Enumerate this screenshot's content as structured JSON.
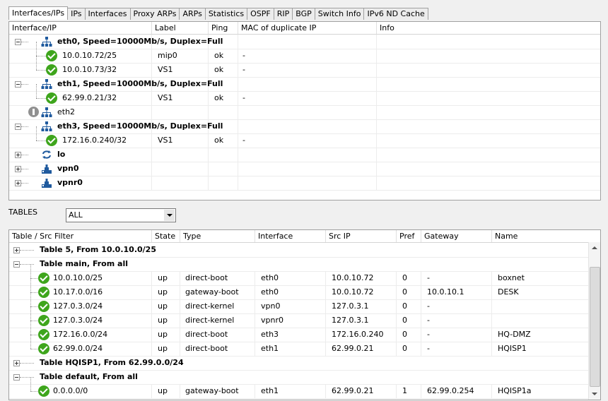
{
  "tabs": [
    "Interfaces/IPs",
    "IPs",
    "Interfaces",
    "Proxy ARPs",
    "ARPs",
    "Statistics",
    "OSPF",
    "RIP",
    "BGP",
    "Switch Info",
    "IPv6 ND Cache"
  ],
  "iface_headers": [
    "Interface/IP",
    "Label",
    "Ping",
    "MAC of duplicate IP",
    "Info"
  ],
  "iface_rows": [
    {
      "type": "iface",
      "icon": "network-icon",
      "name": "eth0, Speed=10000Mb/s, Duplex=Full",
      "bold": true,
      "expander": "minus"
    },
    {
      "type": "ip",
      "ip": "10.0.10.72/25",
      "label": "mip0",
      "ping": "ok",
      "mac": "-"
    },
    {
      "type": "ip",
      "ip": "10.0.10.73/32",
      "label": "VS1",
      "ping": "ok",
      "mac": "-"
    },
    {
      "type": "iface",
      "icon": "network-icon",
      "name": "eth1, Speed=10000Mb/s, Duplex=Full",
      "bold": true,
      "expander": "minus"
    },
    {
      "type": "ip",
      "ip": "62.99.0.21/32",
      "label": "VS1",
      "ping": "ok",
      "mac": "-"
    },
    {
      "type": "iface",
      "icon": "network-icon",
      "warn": true,
      "name": "eth2",
      "bold": false,
      "expander": "none"
    },
    {
      "type": "iface",
      "icon": "network-icon",
      "name": "eth3, Speed=10000Mb/s, Duplex=Full",
      "bold": true,
      "expander": "minus"
    },
    {
      "type": "ip",
      "ip": "172.16.0.240/32",
      "label": "VS1",
      "ping": "ok",
      "mac": "-"
    },
    {
      "type": "iface",
      "icon": "loopback-icon",
      "name": "lo",
      "bold": true,
      "expander": "plus"
    },
    {
      "type": "iface",
      "icon": "vpn-icon",
      "name": "vpn0",
      "bold": true,
      "expander": "plus"
    },
    {
      "type": "iface",
      "icon": "vpn-icon",
      "name": "vpnr0",
      "bold": true,
      "expander": "plus"
    }
  ],
  "tables_label": "TABLES",
  "tables_select": "ALL",
  "route_headers": [
    "Table / Src Filter",
    "State",
    "Type",
    "Interface",
    "Src IP",
    "Pref",
    "Gateway",
    "Name"
  ],
  "route_rows": [
    {
      "type": "table",
      "name": "Table 5, From 10.0.10.0/25",
      "expander": "plus"
    },
    {
      "type": "table",
      "name": "Table main, From all",
      "expander": "minus"
    },
    {
      "type": "route",
      "dest": "10.0.10.0/25",
      "state": "up",
      "rtype": "direct-boot",
      "iface": "eth0",
      "src": "10.0.10.72",
      "pref": "0",
      "gw": "-",
      "name": "boxnet"
    },
    {
      "type": "route",
      "dest": "10.17.0.0/16",
      "state": "up",
      "rtype": "gateway-boot",
      "iface": "eth0",
      "src": "10.0.10.72",
      "pref": "0",
      "gw": "10.0.10.1",
      "name": "DESK"
    },
    {
      "type": "route",
      "dest": "127.0.3.0/24",
      "state": "up",
      "rtype": "direct-kernel",
      "iface": "vpn0",
      "src": "127.0.3.1",
      "pref": "0",
      "gw": "-",
      "name": ""
    },
    {
      "type": "route",
      "dest": "127.0.3.0/24",
      "state": "up",
      "rtype": "direct-kernel",
      "iface": "vpnr0",
      "src": "127.0.3.1",
      "pref": "0",
      "gw": "-",
      "name": ""
    },
    {
      "type": "route",
      "dest": "172.16.0.0/24",
      "state": "up",
      "rtype": "direct-boot",
      "iface": "eth3",
      "src": "172.16.0.240",
      "pref": "0",
      "gw": "-",
      "name": "HQ-DMZ"
    },
    {
      "type": "route",
      "dest": "62.99.0.0/24",
      "state": "up",
      "rtype": "direct-boot",
      "iface": "eth1",
      "src": "62.99.0.21",
      "pref": "0",
      "gw": "-",
      "name": "HQISP1"
    },
    {
      "type": "table",
      "name": "Table HQISP1, From 62.99.0.0/24",
      "expander": "plus"
    },
    {
      "type": "table",
      "name": "Table default, From all",
      "expander": "minus"
    },
    {
      "type": "route",
      "dest": "0.0.0.0/0",
      "state": "up",
      "rtype": "gateway-boot",
      "iface": "eth1",
      "src": "62.99.0.21",
      "pref": "1",
      "gw": "62.99.0.254",
      "name": "HQISP1a"
    }
  ],
  "colors": {
    "ok": "#3ea51c",
    "warn": "#909090",
    "network_icon": "#1f5a9e",
    "loopback_icon": "#1f5a9e"
  }
}
